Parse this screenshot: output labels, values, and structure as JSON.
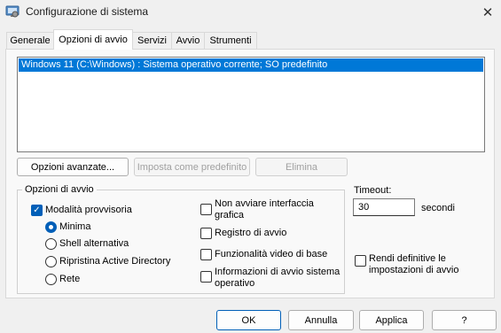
{
  "window": {
    "title": "Configurazione di sistema"
  },
  "tabs": [
    "Generale",
    "Opzioni di avvio",
    "Servizi",
    "Avvio",
    "Strumenti"
  ],
  "boot_entries": [
    "Windows 11 (C:\\Windows) : Sistema operativo corrente; SO predefinito"
  ],
  "list_buttons": {
    "advanced": "Opzioni avanzate...",
    "set_default": "Imposta come predefinito",
    "delete": "Elimina"
  },
  "boot_options": {
    "group_label": "Opzioni di avvio",
    "safe_boot": {
      "label": "Modalità provvisoria",
      "checked": true
    },
    "radios": [
      {
        "label": "Minima",
        "selected": true
      },
      {
        "label": "Shell alternativa",
        "selected": false
      },
      {
        "label": "Ripristina Active Directory",
        "selected": false
      },
      {
        "label": "Rete",
        "selected": false
      }
    ],
    "right_checks": [
      {
        "label_line1": "Non avviare interfaccia",
        "label_line2": "grafica",
        "checked": false
      },
      {
        "label_line1": "Registro di avvio",
        "label_line2": "",
        "checked": false
      },
      {
        "label_line1": "Funzionalità video di base",
        "label_line2": "",
        "checked": false
      },
      {
        "label_line1": "Informazioni di avvio sistema",
        "label_line2": "operativo",
        "checked": false
      }
    ]
  },
  "timeout": {
    "label": "Timeout:",
    "value": "30",
    "unit": "secondi"
  },
  "permanent": {
    "label_line1": "Rendi definitive le",
    "label_line2": "impostazioni di avvio",
    "checked": false
  },
  "footer": {
    "ok": "OK",
    "cancel": "Annulla",
    "apply": "Applica",
    "help": "?"
  },
  "colors": {
    "selection": "#0078d7",
    "accent": "#005fb8"
  }
}
